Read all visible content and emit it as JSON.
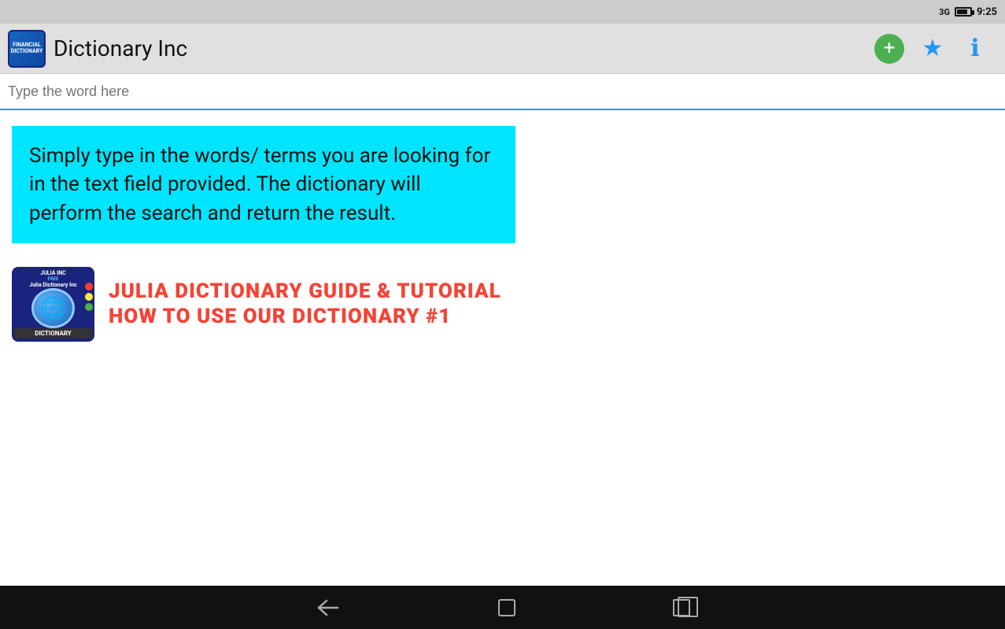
{
  "statusBar": {
    "signal": "3G",
    "time": "9:25"
  },
  "appBar": {
    "title": "Dictionary Inc",
    "addButtonLabel": "+",
    "starButtonLabel": "★",
    "infoButtonLabel": "ⓘ"
  },
  "searchBar": {
    "placeholder": "Type the word here"
  },
  "infoBox": {
    "text": "Simply type in the words/ terms you are looking for in the text field provided. The dictionary will perform the search and return the result."
  },
  "tutorialCard": {
    "titleLine1": "JULIA DICTIONARY GUIDE & TUTORIAL",
    "titleLine2": "HOW TO USE OUR DICTIONARY #1",
    "thumbTopText": "JULIA INC",
    "thumbBottomText": "DICTIONARY"
  },
  "navBar": {
    "backLabel": "back",
    "homeLabel": "home",
    "recentsLabel": "recents"
  }
}
